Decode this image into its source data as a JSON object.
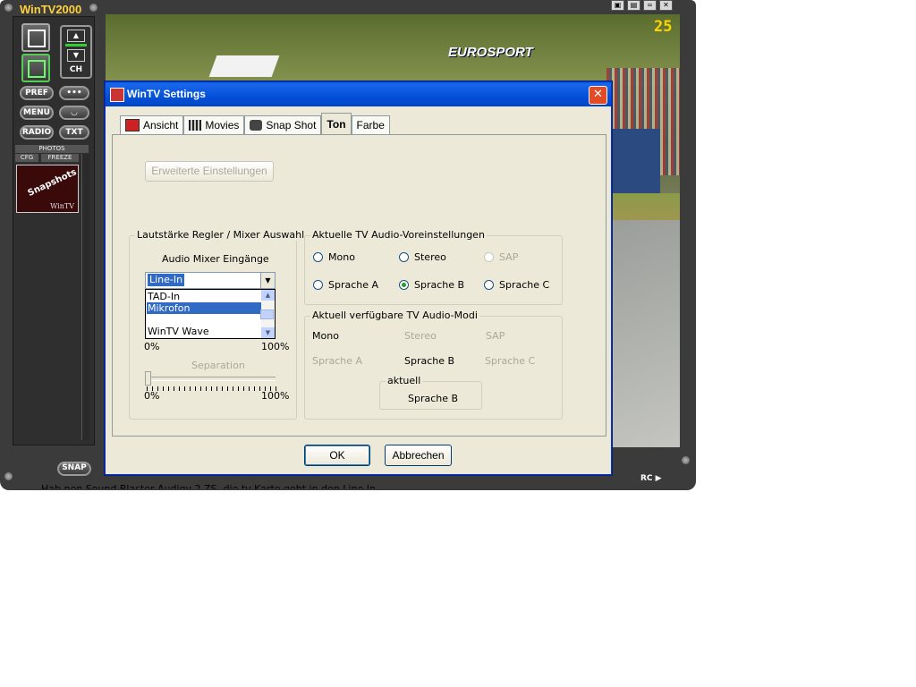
{
  "app": {
    "title": "WinTV2000",
    "channel_number": "25",
    "channel_logo": "EUROSPORT",
    "snap_label": "SNAP",
    "rc_label": "RC",
    "ch_label": "CH",
    "photos_label": "PHOTOS",
    "cfg_label": "CFG",
    "freeze_label": "FREEZE",
    "buttons": {
      "pref": "PREF",
      "menu": "MENU",
      "radio": "RADIO",
      "txt": "TXT"
    },
    "thumb_text": "Snapshots",
    "thumb_brand": "WinTV",
    "window_controls": [
      "▣",
      "▤",
      "=",
      "✕"
    ]
  },
  "overlay_text": "Hab nen Sound Blaster Audigy 2 ZS .die tv Karte geht in den Line In .",
  "dialog": {
    "title": "WinTV Settings",
    "close": "✕",
    "tabs": [
      {
        "label": "Ansicht",
        "icon": "tv-icon"
      },
      {
        "label": "Movies",
        "icon": "film-icon"
      },
      {
        "label": "Snap Shot",
        "icon": "camera-icon"
      },
      {
        "label": "Ton",
        "icon": ""
      },
      {
        "label": "Farbe",
        "icon": ""
      }
    ],
    "active_tab": "Ton",
    "advanced_button": "Erweiterte Einstellungen",
    "volume_group": {
      "legend": "Lautstärke Regler / Mixer Auswahl",
      "mixer_label": "Audio Mixer Eingänge",
      "combo_value": "Line-In",
      "options": [
        "TAD-In",
        "Mikrofon",
        "",
        "WinTV Wave"
      ],
      "selected_option": "Mikrofon",
      "volume_min": "0%",
      "volume_max": "100%",
      "separation_label": "Separation",
      "separation_min": "0%",
      "separation_max": "100%",
      "separation_value": 0
    },
    "presets_group": {
      "legend": "Aktuelle TV Audio-Voreinstellungen",
      "options": [
        {
          "label": "Mono",
          "checked": false,
          "enabled": true
        },
        {
          "label": "Stereo",
          "checked": false,
          "enabled": true
        },
        {
          "label": "SAP",
          "checked": false,
          "enabled": false
        },
        {
          "label": "Sprache A",
          "checked": false,
          "enabled": true
        },
        {
          "label": "Sprache B",
          "checked": true,
          "enabled": true
        },
        {
          "label": "Sprache C",
          "checked": false,
          "enabled": true
        }
      ]
    },
    "modes_group": {
      "legend": "Aktuell verfügbare TV Audio-Modi",
      "modes": [
        {
          "label": "Mono",
          "available": true
        },
        {
          "label": "Stereo",
          "available": false
        },
        {
          "label": "SAP",
          "available": false
        },
        {
          "label": "Sprache A",
          "available": false
        },
        {
          "label": "Sprache B",
          "available": true
        },
        {
          "label": "Sprache C",
          "available": false
        }
      ],
      "current_legend": "aktuell",
      "current_value": "Sprache B"
    },
    "ok_button": "OK",
    "cancel_button": "Abbrechen"
  }
}
